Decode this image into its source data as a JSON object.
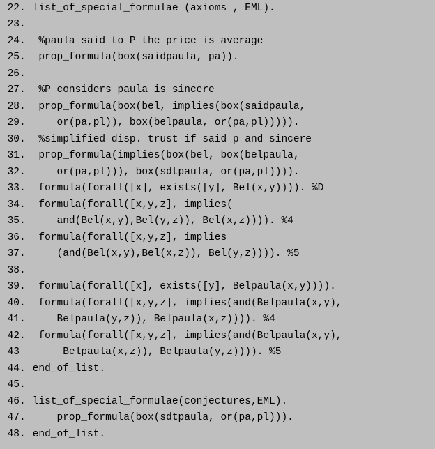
{
  "lines": [
    {
      "num": "22",
      "dot": ".",
      "text": " list_of_special_formulae (axioms , EML)."
    },
    {
      "num": "23",
      "dot": ".",
      "text": ""
    },
    {
      "num": "24",
      "dot": ".",
      "text": "  %paula said to P the price is average"
    },
    {
      "num": "25",
      "dot": ".",
      "text": "  prop_formula(box(saidpaula, pa))."
    },
    {
      "num": "26",
      "dot": ".",
      "text": ""
    },
    {
      "num": "27",
      "dot": ".",
      "text": "  %P considers paula is sincere"
    },
    {
      "num": "28",
      "dot": ".",
      "text": "  prop_formula(box(bel, implies(box(saidpaula,"
    },
    {
      "num": "29",
      "dot": ".",
      "text": "     or(pa,pl)), box(belpaula, or(pa,pl)))))."
    },
    {
      "num": "30",
      "dot": ".",
      "text": "  %simplified disp. trust if said p and sincere"
    },
    {
      "num": "31",
      "dot": ".",
      "text": "  prop_formula(implies(box(bel, box(belpaula,"
    },
    {
      "num": "32",
      "dot": ".",
      "text": "     or(pa,pl))), box(sdtpaula, or(pa,pl))))."
    },
    {
      "num": "33",
      "dot": ".",
      "text": "  formula(forall([x], exists([y], Bel(x,y)))). %D"
    },
    {
      "num": "34",
      "dot": ".",
      "text": "  formula(forall([x,y,z], implies("
    },
    {
      "num": "35",
      "dot": ".",
      "text": "     and(Bel(x,y),Bel(y,z)), Bel(x,z)))). %4"
    },
    {
      "num": "36",
      "dot": ".",
      "text": "  formula(forall([x,y,z], implies"
    },
    {
      "num": "37",
      "dot": ".",
      "text": "     (and(Bel(x,y),Bel(x,z)), Bel(y,z)))). %5"
    },
    {
      "num": "38",
      "dot": ".",
      "text": ""
    },
    {
      "num": "39",
      "dot": ".",
      "text": "  formula(forall([x], exists([y], Belpaula(x,y))))."
    },
    {
      "num": "40",
      "dot": ".",
      "text": "  formula(forall([x,y,z], implies(and(Belpaula(x,y),"
    },
    {
      "num": "41",
      "dot": ".",
      "text": "     Belpaula(y,z)), Belpaula(x,z)))). %4"
    },
    {
      "num": "42",
      "dot": ".",
      "text": "  formula(forall([x,y,z], implies(and(Belpaula(x,y),"
    },
    {
      "num": "43",
      "dot": "",
      "text": "      Belpaula(x,z)), Belpaula(y,z)))). %5"
    },
    {
      "num": "44",
      "dot": ".",
      "text": " end_of_list."
    },
    {
      "num": "45",
      "dot": ".",
      "text": ""
    },
    {
      "num": "46",
      "dot": ".",
      "text": " list_of_special_formulae(conjectures,EML)."
    },
    {
      "num": "47",
      "dot": ".",
      "text": "     prop_formula(box(sdtpaula, or(pa,pl)))."
    },
    {
      "num": "48",
      "dot": ".",
      "text": " end_of_list."
    }
  ]
}
